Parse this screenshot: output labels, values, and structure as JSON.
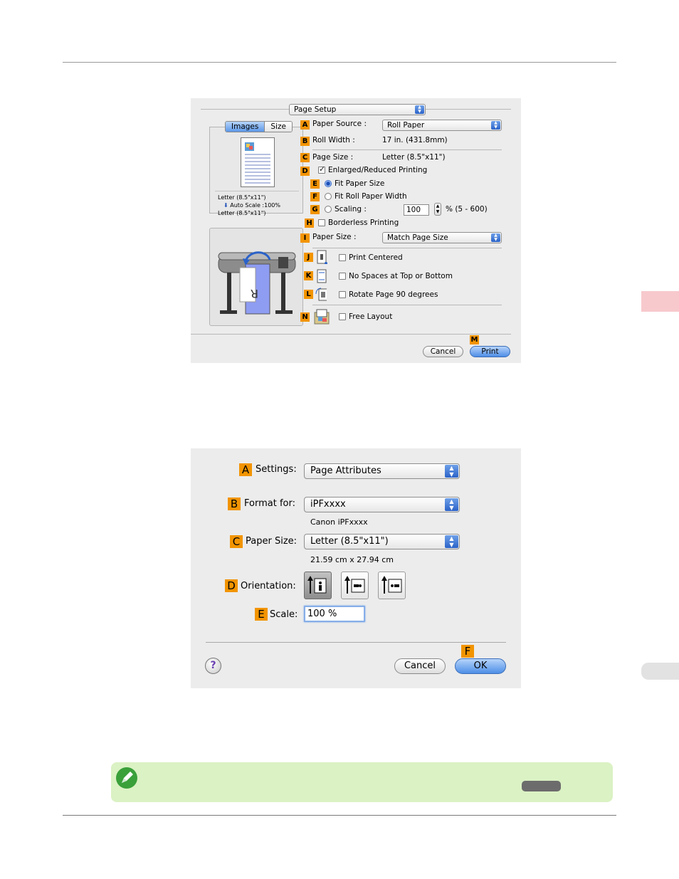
{
  "dialog1": {
    "page_setup_label": "Page Setup",
    "tabs": [
      "Images",
      "Size"
    ],
    "preview_info": {
      "line1": "Letter (8.5\"x11\")",
      "line2": "Auto Scale :100%",
      "line3": "Letter (8.5\"x11\")"
    },
    "badges": [
      "A",
      "B",
      "C",
      "D",
      "E",
      "F",
      "G",
      "H",
      "I",
      "J",
      "K",
      "L",
      "N",
      "M"
    ],
    "paper_source_label": "Paper Source :",
    "paper_source_value": "Roll Paper",
    "roll_width_label": "Roll Width :",
    "roll_width_value": "17 in. (431.8mm)",
    "page_size_label": "Page Size :",
    "page_size_value": "Letter (8.5\"x11\")",
    "enlarged_label": "Enlarged/Reduced Printing",
    "fit_paper_label": "Fit Paper Size",
    "fit_roll_label": "Fit Roll Paper Width",
    "scaling_label": "Scaling :",
    "scaling_value": "100",
    "scaling_range": "% (5 - 600)",
    "borderless_label": "Borderless Printing",
    "paper_size_label": "Paper Size :",
    "paper_size_value": "Match Page Size",
    "print_centered_label": "Print Centered",
    "no_spaces_label": "No Spaces at Top or Bottom",
    "rotate_label": "Rotate Page 90 degrees",
    "free_layout_label": "Free Layout",
    "cancel_label": "Cancel",
    "print_label": "Print"
  },
  "dialog2": {
    "badges": [
      "A",
      "B",
      "C",
      "D",
      "E",
      "F"
    ],
    "settings_label": "Settings:",
    "settings_value": "Page Attributes",
    "format_label": "Format for:",
    "format_value": "iPFxxxx",
    "format_sub": "Canon iPFxxxx",
    "paper_size_label": "Paper Size:",
    "paper_size_value": "Letter (8.5\"x11\")",
    "paper_size_sub": "21.59 cm x 27.94 cm",
    "orientation_label": "Orientation:",
    "scale_label": "Scale:",
    "scale_value": "100 %",
    "help_label": "?",
    "cancel_label": "Cancel",
    "ok_label": "OK"
  },
  "colors": {
    "badge": "#f29400",
    "note_bg": "#dbf2c4",
    "side_tab": "#f7c9cc",
    "aqua_blue": "#4d8ee6"
  }
}
